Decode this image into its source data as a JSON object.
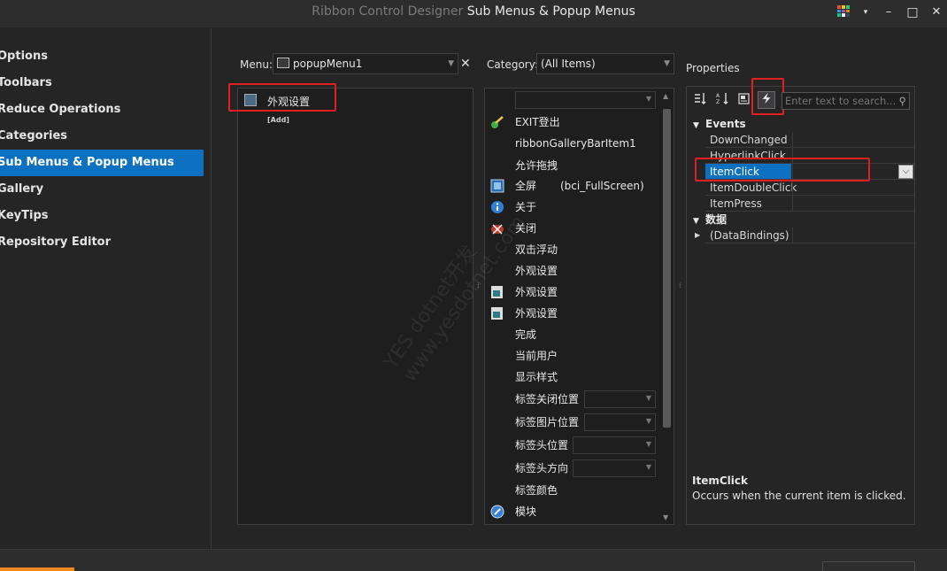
{
  "window": {
    "title_prefix": "Ribbon Control Designer",
    "title_main": "Sub Menus & Popup Menus",
    "minimize": "▾",
    "restore": "–",
    "maximize": "□",
    "close": "✕"
  },
  "nav": {
    "items": [
      {
        "label": "Options"
      },
      {
        "label": "Toolbars"
      },
      {
        "label": "Reduce Operations"
      },
      {
        "label": "Categories"
      },
      {
        "label": "Sub Menus & Popup Menus",
        "active": true
      },
      {
        "label": "Gallery"
      },
      {
        "label": "KeyTips"
      },
      {
        "label": "Repository Editor"
      }
    ]
  },
  "menu": {
    "label": "Menu:",
    "value": "popupMenu1",
    "close": "✕",
    "items": [
      {
        "label": "外观设置"
      }
    ],
    "add": "[Add]"
  },
  "category": {
    "label": "Category:",
    "value": "(All Items)"
  },
  "items": [
    {
      "label": "EXIT登出",
      "icon": "exit-icon"
    },
    {
      "label": "ribbonGalleryBarItem1"
    },
    {
      "label": "允许拖拽"
    },
    {
      "label": "全屏",
      "extra": "(bci_FullScreen)",
      "icon": "fullscreen-icon"
    },
    {
      "label": "关于",
      "icon": "info-icon"
    },
    {
      "label": "关闭",
      "icon": "close-app-icon"
    },
    {
      "label": "双击浮动"
    },
    {
      "label": "外观设置"
    },
    {
      "label": "外观设置",
      "icon": "appearance-icon"
    },
    {
      "label": "外观设置",
      "icon": "appearance-icon"
    },
    {
      "label": "完成"
    },
    {
      "label": "当前用户"
    },
    {
      "label": "显示样式"
    },
    {
      "label": "标签关闭位置",
      "combo": true
    },
    {
      "label": "标签图片位置",
      "combo": true
    },
    {
      "label": "标签头位置",
      "combo": true
    },
    {
      "label": "标签头方向",
      "combo": true
    },
    {
      "label": "标签颜色"
    },
    {
      "label": "模块",
      "icon": "module-icon"
    }
  ],
  "properties": {
    "title": "Properties",
    "search_placeholder": "Enter text to search...",
    "categories": [
      {
        "label": "Events",
        "expanded": true
      },
      {
        "label": "数据",
        "expanded": true
      }
    ],
    "events": [
      "DownChanged",
      "HyperlinkClick",
      "ItemClick",
      "ItemDoubleClick",
      "ItemPress"
    ],
    "data": [
      "(DataBindings)"
    ],
    "selected": "ItemClick",
    "description_title": "ItemClick",
    "description_text": "Occurs when the current item is clicked."
  },
  "colors": {
    "accent": "#0e70c0",
    "highlight": "#e02020",
    "background": "#252526"
  },
  "watermark": {
    "line1": "YES dotnet开发",
    "line2": "www.yesdotnet.com"
  }
}
